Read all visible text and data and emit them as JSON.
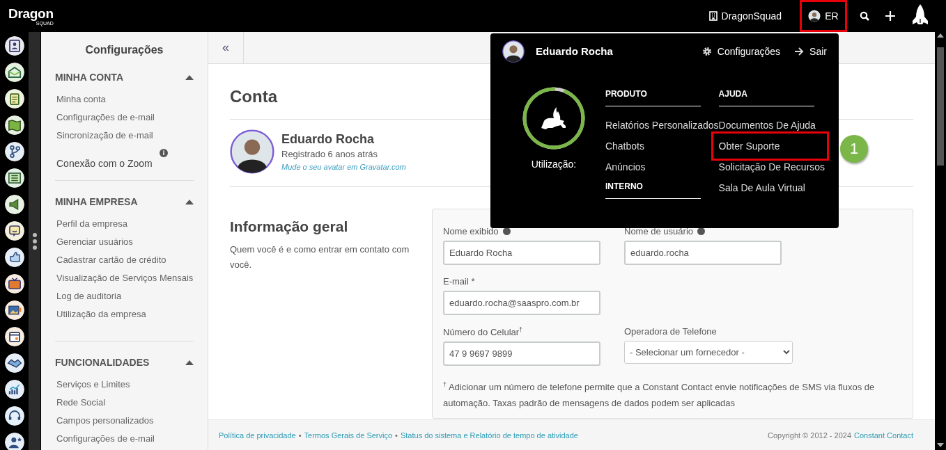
{
  "top_bar": {
    "logo": {
      "text": "Dragon",
      "subtext": "SQUAD"
    },
    "account": "DragonSquad",
    "user": {
      "initials": "ER",
      "highlighted": true
    }
  },
  "settings_sidebar": {
    "title": "Configurações",
    "sections": [
      {
        "title": "MINHA CONTA",
        "expanded": true,
        "items": [
          {
            "label": "Minha conta",
            "info": false
          },
          {
            "label": "Configurações de e-mail",
            "info": false
          },
          {
            "label": "Sincronização de e-mail",
            "info": false
          },
          {
            "label": "Conexão com o Zoom",
            "info": true
          }
        ]
      },
      {
        "title": "MINHA EMPRESA",
        "expanded": true,
        "items": [
          {
            "label": "Perfil da empresa",
            "info": false
          },
          {
            "label": "Gerenciar usuários",
            "info": false
          },
          {
            "label": "Cadastrar cartão de crédito",
            "info": false
          },
          {
            "label": "Visualização de Serviços Mensais",
            "info": false
          },
          {
            "label": "Log de auditoria",
            "info": false
          },
          {
            "label": "Utilização da empresa",
            "info": false
          }
        ]
      },
      {
        "title": "FUNCIONALIDADES",
        "expanded": true,
        "items": [
          {
            "label": "Serviços e Limites",
            "info": false
          },
          {
            "label": "Rede Social",
            "info": false
          },
          {
            "label": "Campos personalizados",
            "info": false
          },
          {
            "label": "Configurações de e-mail",
            "info": false
          }
        ]
      }
    ]
  },
  "main": {
    "collapse_button": "«",
    "page_title": "Conta",
    "profile": {
      "name": "Eduardo Rocha",
      "registered": "Registrado 6 anos atrás",
      "avatar_link": "Mude o seu avatar em Gravatar.com"
    },
    "section": {
      "title": "Informação geral",
      "description": "Quem você é e como entrar em contato com você.",
      "rows": [
        [
          {
            "kind": "text",
            "label": "Nome exibido",
            "help": true,
            "value": "Eduardo Rocha"
          },
          {
            "kind": "text",
            "label": "Nome de usuário",
            "help": true,
            "value": "eduardo.rocha"
          }
        ],
        [
          {
            "kind": "text",
            "label": "E-mail *",
            "help": false,
            "value": "eduardo.rocha@saaspro.com.br"
          }
        ],
        [
          {
            "kind": "text",
            "label": "Número do Celular$^{†}$",
            "help": false,
            "value": "47 9 9697 9899"
          },
          {
            "kind": "select",
            "label": "Operadora de Telefone",
            "help": false,
            "value": "- Selecionar um fornecedor -"
          }
        ]
      ],
      "footnote": "$^{†}$ Adicionar um número de telefone permite que a Constant Contact envie notificações de SMS via fluxos de automação. Taxas padrão de mensagens de dados podem ser aplicadas"
    }
  },
  "footer": {
    "links": [
      "Política de privacidade",
      "Termos Gerais de Serviço",
      "Status do sistema e Relatório de tempo de atividade"
    ],
    "separator": "•",
    "copyright": "Copyright © 2012 - 2024",
    "company_link": "Constant Contact"
  },
  "user_menu": {
    "name": "Eduardo Rocha",
    "settings": "Configurações",
    "logout": "Sair",
    "usage": {
      "label": "Utilização:",
      "level": 0.95
    },
    "columns": [
      {
        "groups": [
          {
            "title": "PRODUTO",
            "items": [
              {
                "label": "Relatórios Personalizados",
                "highlighted": false
              },
              {
                "label": "Chatbots",
                "highlighted": false
              },
              {
                "label": "Anúncios",
                "highlighted": false
              }
            ]
          },
          {
            "title": "INTERNO"
          }
        ]
      },
      {
        "groups": [
          {
            "title": "AJUDA",
            "items": [
              {
                "label": "Documentos De Ajuda",
                "highlighted": false
              },
              {
                "label": "Obter Suporte",
                "highlighted": true,
                "callout": "1"
              },
              {
                "label": "Solicitação De Recursos",
                "highlighted": false
              },
              {
                "label": "Sala De Aula Virtual",
                "highlighted": false
              }
            ]
          }
        ]
      }
    ]
  }
}
